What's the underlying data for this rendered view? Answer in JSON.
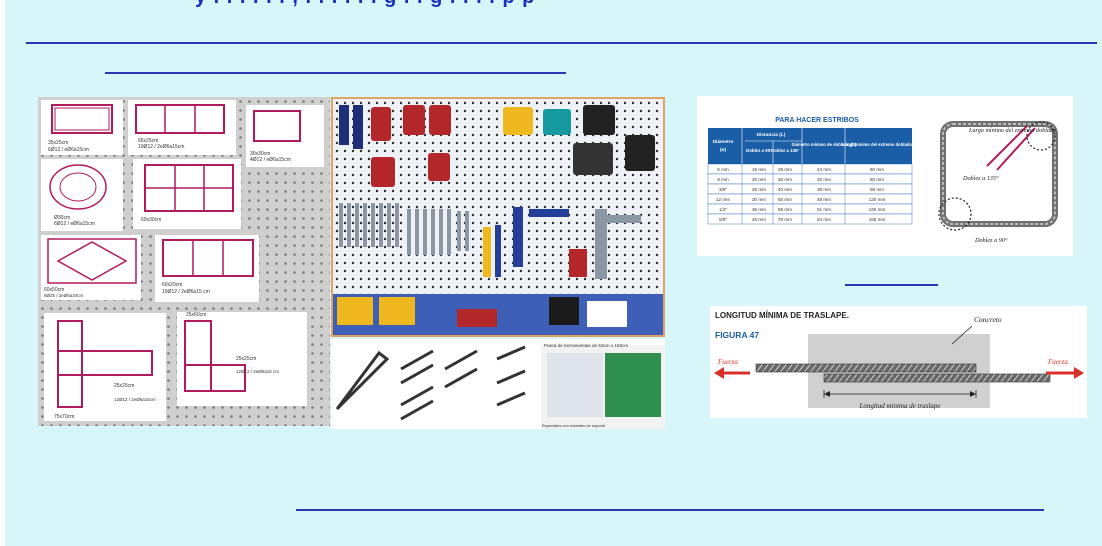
{
  "slide": {
    "title_fragment": "y . . . . . . , . . . . . . g . . g . . . . p p",
    "background": "#d6f6fa",
    "rule_color": "#2a37b5"
  },
  "panels": {
    "left_photo": {
      "sections": [
        {
          "size": "35x25cm",
          "bars": "6Ø12 / eØ6a15cm"
        },
        {
          "size": "65x25cm",
          "bars": "10Ø12 / 2eØ6a15cm"
        },
        {
          "size": "30x30cm",
          "bars": "4Ø12 / eØ6a15cm"
        },
        {
          "size": "Ø30cm",
          "bars": "6Ø12 / eØ6a15cm"
        },
        {
          "size": "60x30cm",
          "bars": ""
        },
        {
          "size": "60x50cm",
          "bars": "9Ø25 / 2eØ5a20cm"
        },
        {
          "size": "60x20cm",
          "bars": "10Ø12 / 2eØ6a15 cm"
        },
        {
          "size": "25x60cm",
          "bars": ""
        },
        {
          "size": "25x25cm",
          "bars": "12Ø12 / 2eØ6a15 cm"
        },
        {
          "size": "25x25cm",
          "bars": "12Ø12 / 2eØ6a15cm"
        },
        {
          "size": "75x70cm",
          "bars": ""
        }
      ]
    },
    "tool_photo": {
      "caption_top": "Pared de herramientas de 53cm x 150cm",
      "caption_bottom": "Especiales con estantes de soporte"
    },
    "stirrup_table": {
      "title": "PARA HACER ESTRIBOS",
      "headers": {
        "diameter": "Diámetro",
        "diameter_unit": "(ø)",
        "distance": "Distancia (L)",
        "bend90": "Doblez a 90°",
        "bend135": "Doblez a 135°",
        "bend_diameter": "Diámetro mínimo de doblado (D)",
        "min_length": "Largo mínimo del extremo doblado"
      },
      "rows": [
        [
          "6 mm",
          "15 mm",
          "25 mm",
          "24 mm",
          "60 mm"
        ],
        [
          "8 mm",
          "20 mm",
          "30 mm",
          "32 mm",
          "80 mm"
        ],
        [
          "3/8\"",
          "25 mm",
          "40 mm",
          "38 mm",
          "95 mm"
        ],
        [
          "12 mm",
          "30 mm",
          "50 mm",
          "48 mm",
          "120 mm"
        ],
        [
          "1/2\"",
          "35 mm",
          "55 mm",
          "51 mm",
          "130 mm"
        ],
        [
          "5/8\"",
          "45 mm",
          "70 mm",
          "64 mm",
          "160 mm"
        ]
      ],
      "diagram_labels": {
        "min_length": "Largo mínimo del extremo doblado",
        "bend135": "Doblez a 135°",
        "bend90": "Doblez a 90°"
      }
    },
    "lap_figure": {
      "title": "LONGITUD MÍNIMA DE TRASLAPE.",
      "figure_label": "FIGURA 47",
      "concrete_label": "Concreto",
      "force_left": "Fuerza",
      "force_right": "Fuerza",
      "lap_label": "Longitud mínima de traslape"
    }
  }
}
